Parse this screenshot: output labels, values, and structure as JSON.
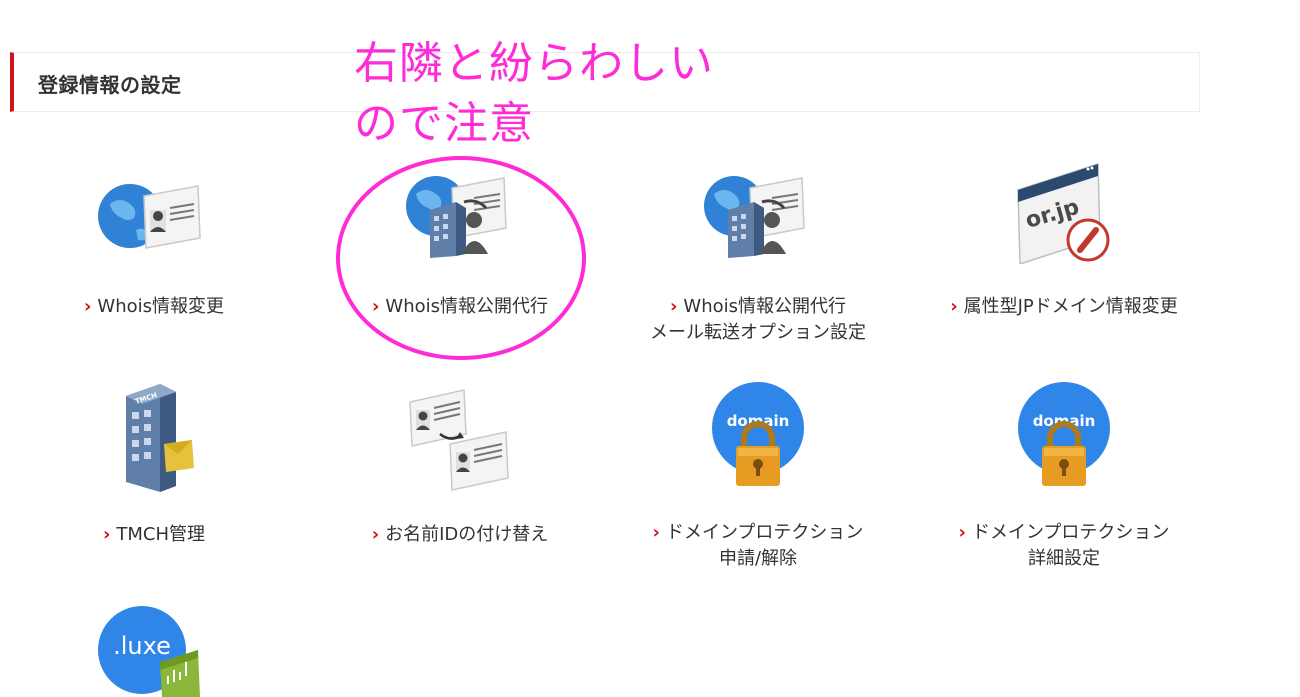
{
  "section": {
    "title": "登録情報の設定"
  },
  "annotation": {
    "line1": "右隣と紛らわしい",
    "line2": "ので注意",
    "color": "#ff2bd6"
  },
  "accent_color": "#d0121b",
  "tiles": [
    {
      "icon": "globe-id-card-icon",
      "line1": "Whois情報変更",
      "line2": ""
    },
    {
      "icon": "globe-building-proxy-icon",
      "line1": "Whois情報公開代行",
      "line2": ""
    },
    {
      "icon": "globe-building-proxy-mail-icon",
      "line1": "Whois情報公開代行",
      "line2": "メール転送オプション設定"
    },
    {
      "icon": "orjp-window-edit-icon",
      "line1": "属性型JPドメイン情報変更",
      "line2": "",
      "icon_text": "or.jp"
    },
    {
      "icon": "tmch-building-icon",
      "line1": "TMCH管理",
      "line2": "",
      "icon_text": "TMCH"
    },
    {
      "icon": "id-card-transfer-icon",
      "line1": "お名前IDの付け替え",
      "line2": ""
    },
    {
      "icon": "domain-lock-icon",
      "line1": "ドメインプロテクション",
      "line2": "申請/解除",
      "icon_text": "domain"
    },
    {
      "icon": "domain-lock-settings-icon",
      "line1": "ドメインプロテクション",
      "line2": "詳細設定",
      "icon_text": "domain"
    },
    {
      "icon": "luxe-icon",
      "line1": "",
      "line2": "",
      "icon_text": ".luxe"
    }
  ]
}
